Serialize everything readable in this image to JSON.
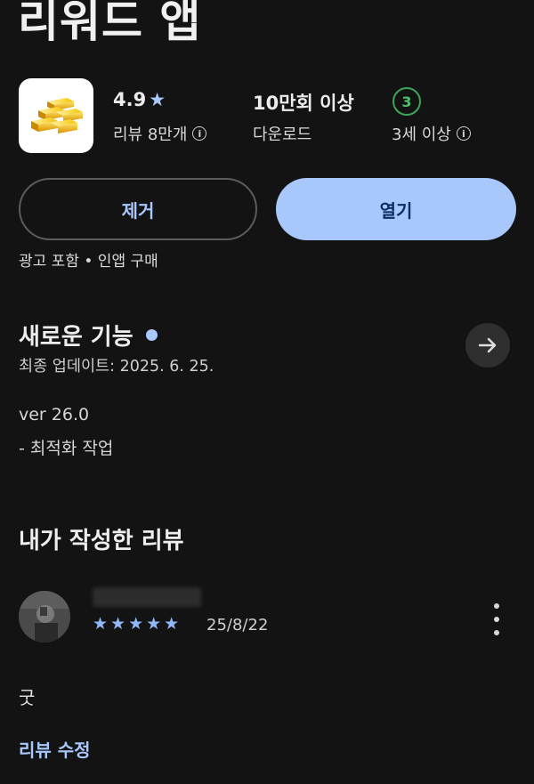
{
  "app": {
    "title": "리워드 앱",
    "icon": "gold-bars-icon"
  },
  "stats": {
    "rating": "4.9",
    "rating_star": "★",
    "reviews": "리뷰 8만개",
    "downloads": "10만회 이상",
    "downloads_label": "다운로드",
    "age_badge": "3",
    "age_label": "3세 이상"
  },
  "buttons": {
    "remove": "제거",
    "open": "열기"
  },
  "ads_notice": "광고 포함 • 인앱 구매",
  "whats_new": {
    "title": "새로운 기능",
    "updated": "최종 업데이트: 2025. 6. 25.",
    "version": "ver 26.0",
    "notes": "- 최적화 작업"
  },
  "my_review": {
    "title": "내가 작성한 리뷰",
    "stars": "★★★★★",
    "rating_value": 5,
    "date": "25/8/22",
    "text": "굿",
    "edit_label": "리뷰 수정"
  },
  "colors": {
    "background": "#131313",
    "accent": "#a8c8fb",
    "age_badge": "#3ea45a"
  }
}
